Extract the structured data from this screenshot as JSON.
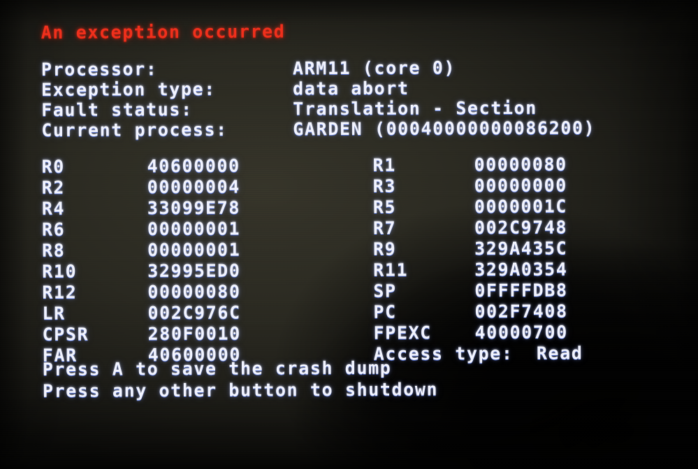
{
  "title": "An exception occurred",
  "colors": {
    "title_red": "#f0301c",
    "text_white": "#f2f4ff",
    "background": "#2b2a22"
  },
  "header": {
    "rows": [
      {
        "label": "Processor:",
        "value": "ARM11 (core 0)"
      },
      {
        "label": "Exception type:",
        "value": "data abort"
      },
      {
        "label": "Fault status:",
        "value": "Translation - Section"
      },
      {
        "label": "Current process:",
        "value": "GARDEN (00040000000086200)"
      }
    ]
  },
  "registers": {
    "left": [
      {
        "name": "R0",
        "value": "40600000"
      },
      {
        "name": "R2",
        "value": "00000004"
      },
      {
        "name": "R4",
        "value": "33099E78"
      },
      {
        "name": "R6",
        "value": "00000001"
      },
      {
        "name": "R8",
        "value": "00000001"
      },
      {
        "name": "R10",
        "value": "32995ED0"
      },
      {
        "name": "R12",
        "value": "00000080"
      },
      {
        "name": "LR",
        "value": "002C976C"
      },
      {
        "name": "CPSR",
        "value": "280F0010"
      },
      {
        "name": "FAR",
        "value": "40600000"
      }
    ],
    "right": [
      {
        "name": "R1",
        "value": "00000080"
      },
      {
        "name": "R3",
        "value": "00000000"
      },
      {
        "name": "R5",
        "value": "0000001C"
      },
      {
        "name": "R7",
        "value": "002C9748"
      },
      {
        "name": "R9",
        "value": "329A435C"
      },
      {
        "name": "R11",
        "value": "329A0354"
      },
      {
        "name": "SP",
        "value": "0FFFFDB8"
      },
      {
        "name": "PC",
        "value": "002F7408"
      },
      {
        "name": "FPEXC",
        "value": "40000700"
      }
    ]
  },
  "access": {
    "label": "Access type:",
    "value": "Read"
  },
  "footer": {
    "lines": [
      "Press A to save the crash dump",
      "Press any other button to shutdown"
    ]
  }
}
